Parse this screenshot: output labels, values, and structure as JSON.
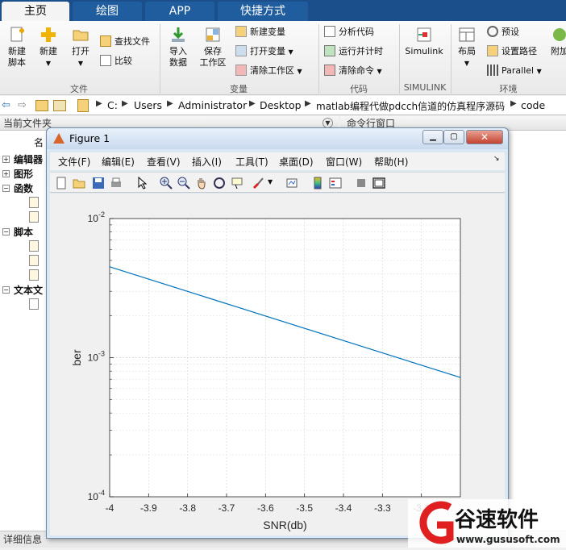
{
  "ribbon": {
    "tabs": [
      "主页",
      "绘图",
      "APP",
      "快捷方式"
    ],
    "file_group": {
      "label": "文件",
      "new_script": "新建\n脚本",
      "new": "新建",
      "open": "打开",
      "find_files": "查找文件",
      "compare": "比较"
    },
    "variable_group": {
      "label": "变量",
      "import": "导入\n数据",
      "save_ws": "保存\n工作区",
      "new_var": "新建变量",
      "open_var": "打开变量",
      "clear_ws": "清除工作区"
    },
    "code_group": {
      "label": "代码",
      "analyze": "分析代码",
      "run_time": "运行并计时",
      "clear_cmd": "清除命令"
    },
    "simulink_group": {
      "label": "SIMULINK",
      "simulink": "Simulink"
    },
    "env_group": {
      "label": "环境",
      "layout": "布局",
      "prefs": "预设",
      "set_path": "设置路径",
      "parallel": "Parallel",
      "addons": "附加"
    }
  },
  "address": {
    "crumbs": [
      "C:",
      "Users",
      "Administrator",
      "Desktop",
      "matlab编程代做pdcch信道的仿真程序源码",
      "code"
    ]
  },
  "panels": {
    "current_folder": "当前文件夹",
    "name_col": "名",
    "command_window": "命令行窗口",
    "details": "详细信息"
  },
  "tree": [
    {
      "label": "编辑器",
      "box": "+"
    },
    {
      "label": "图形",
      "box": "+"
    },
    {
      "label": "函数",
      "box": "−"
    },
    {
      "label": "脚本",
      "box": "−"
    },
    {
      "label": "文本文",
      "box": "−"
    }
  ],
  "figure": {
    "title": "Figure 1",
    "menus": [
      "文件(F)",
      "编辑(E)",
      "查看(V)",
      "插入(I)",
      "工具(T)",
      "桌面(D)",
      "窗口(W)",
      "帮助(H)"
    ]
  },
  "chart_data": {
    "type": "line",
    "title": "",
    "xlabel": "SNR(db)",
    "ylabel": "ber",
    "xlim": [
      -4,
      -3.1
    ],
    "ylim": [
      0.0001,
      0.01
    ],
    "yscale": "log",
    "grid": true,
    "xticks": [
      "-4",
      "-3.9",
      "-3.8",
      "-3.7",
      "-3.6",
      "-3.5",
      "-3.4",
      "-3.3",
      "-3.2"
    ],
    "yticks": [
      "10",
      "10",
      "10"
    ],
    "ytick_exponents": [
      "-2",
      "-3",
      "-4"
    ],
    "series": [
      {
        "color": "#0072bd",
        "x": [
          -4,
          -3.1
        ],
        "y": [
          0.0045,
          0.00072
        ]
      }
    ]
  },
  "watermark": {
    "brand": "谷速软件",
    "url": "www.gususoft.com"
  }
}
